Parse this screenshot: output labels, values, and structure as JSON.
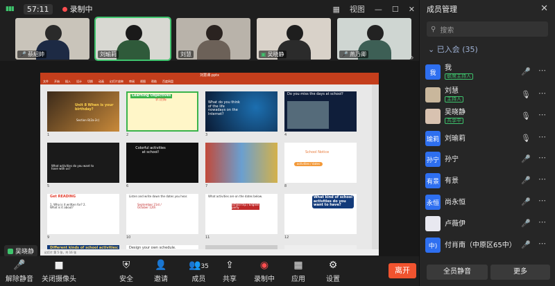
{
  "topbar": {
    "signal": "▮▮▮",
    "timer": "57:11",
    "recording": "录制中",
    "view": "视图"
  },
  "participants": [
    {
      "name": "蔡紹帥"
    },
    {
      "name": "刘瑜莉"
    },
    {
      "name": "刘慧"
    },
    {
      "name": "吴晓静"
    },
    {
      "name": "燕乃卿"
    }
  ],
  "presentation": {
    "window_title": "刘慧课.pptx",
    "ribbon": [
      "文件",
      "开始",
      "插入",
      "设计",
      "切换",
      "动画",
      "幻灯片放映",
      "审阅",
      "视图",
      "帮助",
      "百度网盘"
    ],
    "status": "幻灯片 第 5 张，共 16 张",
    "slides": [
      {
        "n": "1",
        "title": "Unit 8 When is your birthday?",
        "sub": "Section B(2a-2c)"
      },
      {
        "n": "2",
        "title": "Learning Objectives",
        "sub": "学习目标"
      },
      {
        "n": "3",
        "title": "What do you think of the life nowadays on the Internet?",
        "sub": ""
      },
      {
        "n": "4",
        "title": "Do you miss the days at school?",
        "sub": ""
      },
      {
        "n": "5",
        "title": "What activities do you want to have with us?",
        "sub": ""
      },
      {
        "n": "6",
        "title": "Colorful activities at school!",
        "sub": ""
      },
      {
        "n": "7",
        "title": "",
        "sub": ""
      },
      {
        "n": "8",
        "title": "School Notice",
        "sub": "activities / dates"
      },
      {
        "n": "9",
        "title": "Get READING",
        "sub": "1. Who is it written for? 2. What is it about?"
      },
      {
        "n": "10",
        "title": "Listen and write down the dates you hear.",
        "sub": "September 21st / October 12th"
      },
      {
        "n": "11",
        "title": "What activities are on the dates below.",
        "sub": "school trip / English party"
      },
      {
        "n": "12",
        "title": "What kind of school activities do you want to have?",
        "sub": ""
      },
      {
        "n": "",
        "title": "Different kinds of school activities:",
        "sub": ""
      },
      {
        "n": "",
        "title": "Design your own schedule.",
        "sub": ""
      }
    ]
  },
  "speaker_badge": "吴晓静",
  "toolbar": [
    {
      "label": "解除静音",
      "icon": "🎤"
    },
    {
      "label": "关闭摄像头",
      "icon": "■"
    },
    {
      "label": "安全",
      "icon": "⛨"
    },
    {
      "label": "邀请",
      "icon": "👤"
    },
    {
      "label": "成员",
      "icon": "👥",
      "count": "35"
    },
    {
      "label": "共享",
      "icon": "⇪"
    },
    {
      "label": "录制中",
      "icon": "◉"
    },
    {
      "label": "应用",
      "icon": "▦"
    },
    {
      "label": "设置",
      "icon": "⚙"
    }
  ],
  "leave": "离开",
  "panel": {
    "title": "成员管理",
    "search": "搜索",
    "group": "已入会 (35)",
    "members": [
      {
        "avatar": "我",
        "name": "我",
        "role": "联席主持人",
        "mic": "muted"
      },
      {
        "avatar": "",
        "name": "刘慧",
        "role": "主持人",
        "mic": "on"
      },
      {
        "avatar": "",
        "name": "吴晓静",
        "role": "共享中",
        "mic": "on"
      },
      {
        "avatar": "瑜莉",
        "name": "刘瑜莉",
        "role": "",
        "mic": "on"
      },
      {
        "avatar": "孙宁",
        "name": "孙宁",
        "role": "",
        "mic": "muted"
      },
      {
        "avatar": "有景",
        "name": "有景",
        "role": "",
        "mic": "muted"
      },
      {
        "avatar": "永恒",
        "name": "尚永恒",
        "role": "",
        "mic": "muted"
      },
      {
        "avatar": "",
        "name": "卢薇伊",
        "role": "",
        "mic": "muted"
      },
      {
        "avatar": "中)",
        "name": "付肖南（中原区65中）",
        "role": "",
        "mic": "muted"
      }
    ],
    "mute_all": "全员静音",
    "more": "更多"
  },
  "colors": {
    "accent": "#3ec46d",
    "danger": "#ff4d4f",
    "leave": "#f0532f",
    "avatar": "#2e6ff0"
  }
}
